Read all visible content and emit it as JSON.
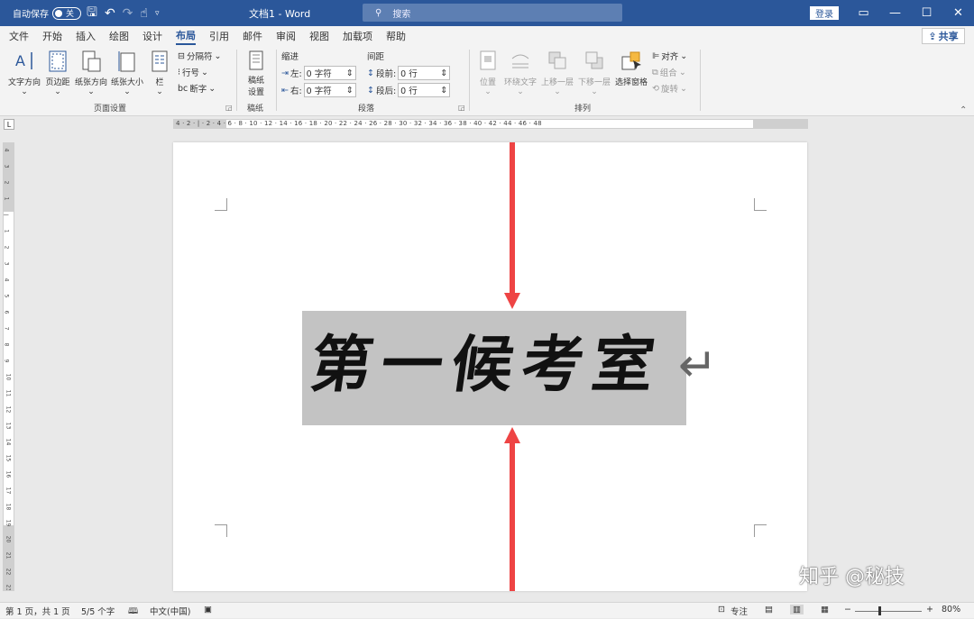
{
  "titlebar": {
    "autosave_label": "自动保存",
    "autosave_state": "关",
    "doc_title": "文档1 - Word",
    "search_placeholder": "搜索",
    "login": "登录",
    "controls": [
      "▭",
      "—",
      "☐",
      "✕"
    ]
  },
  "tabs": [
    "文件",
    "开始",
    "插入",
    "绘图",
    "设计",
    "布局",
    "引用",
    "邮件",
    "审阅",
    "视图",
    "加载项",
    "帮助"
  ],
  "active_tab": "布局",
  "share": "共享",
  "ribbon": {
    "page_setup": {
      "text_direction": "文字方向",
      "margins": "页边距",
      "orientation": "纸张方向",
      "size": "纸张大小",
      "columns": "栏",
      "breaks": "分隔符",
      "line_numbers": "行号",
      "hyphenation": "断字",
      "label": "页面设置"
    },
    "manuscript": {
      "button": "稿纸",
      "button2": "设置",
      "label": "稿纸"
    },
    "paragraph": {
      "indent_title": "缩进",
      "spacing_title": "间距",
      "left_label": "左:",
      "right_label": "右:",
      "left_value": "0 字符",
      "right_value": "0 字符",
      "before_label": "段前:",
      "after_label": "段后:",
      "before_value": "0 行",
      "after_value": "0 行",
      "label": "段落"
    },
    "arrange": {
      "position": "位置",
      "wrap_text": "环绕文字",
      "bring_forward": "上移一层",
      "send_backward": "下移一层",
      "selection_pane": "选择窗格",
      "align": "对齐",
      "group": "组合",
      "rotate": "旋转",
      "label": "排列"
    }
  },
  "ruler": {
    "h_ticks": "4 · 2 · | · 2 · 4 · 6 · 8 · 10 · 12 · 14 · 16 · 18 · 20 · 22 · 24 · 26 · 28 · 30 · 32 · 34 · 36 · 38 · 40 · 42 · 44 · 46 · 48",
    "tab_selector": "L"
  },
  "document": {
    "chars": [
      "第",
      "一",
      "候",
      "考",
      "室"
    ],
    "paragraph_mark": "↵"
  },
  "watermark": "知乎 @秘技",
  "status": {
    "page": "第 1 页，共 1 页",
    "words": "5/5 个字",
    "language": "中文(中国)",
    "focus": "专注",
    "zoom_minus": "−",
    "zoom_plus": "+",
    "zoom": "80%"
  },
  "colors": {
    "title_bg": "#2b579a",
    "accent_arrow": "#ee4444",
    "textbox_bg": "#c3c3c3"
  }
}
